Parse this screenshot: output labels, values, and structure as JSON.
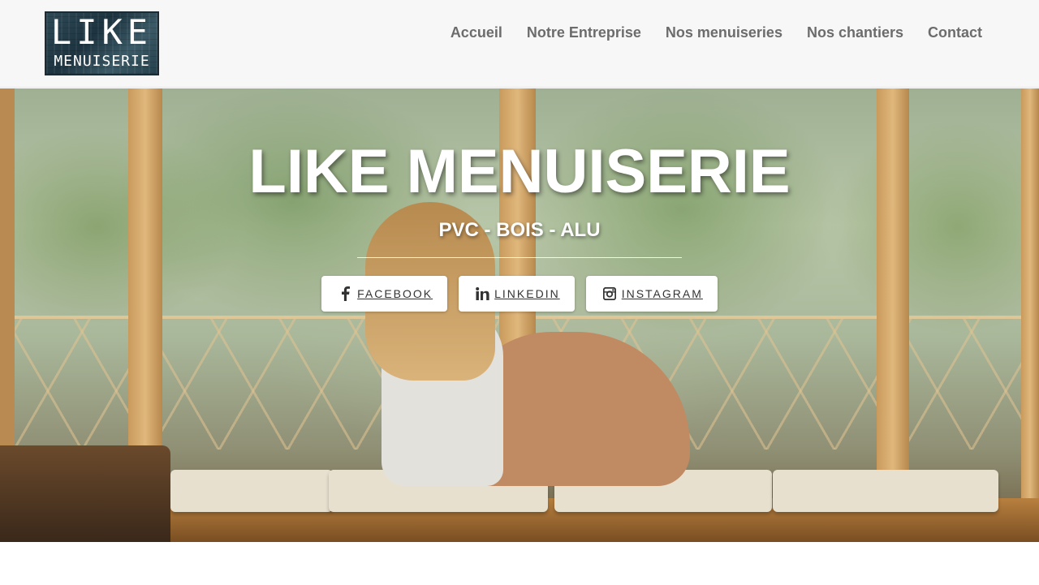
{
  "header": {
    "logo": {
      "line1": "LIKE",
      "line2": "MENUISERIE"
    },
    "nav": [
      {
        "label": "Accueil"
      },
      {
        "label": "Notre Entreprise"
      },
      {
        "label": "Nos menuiseries"
      },
      {
        "label": "Nos chantiers"
      },
      {
        "label": "Contact"
      }
    ]
  },
  "hero": {
    "title": "LIKE MENUISERIE",
    "subtitle": "PVC - BOIS - ALU",
    "social_buttons": [
      {
        "label": "FACEBOOK",
        "icon": "facebook-icon"
      },
      {
        "label": "LINKEDIN",
        "icon": "linkedin-icon"
      },
      {
        "label": "INSTAGRAM",
        "icon": "instagram-icon"
      }
    ]
  },
  "colors": {
    "header_bg": "#f7f7f7",
    "nav_text": "#6c6c6c",
    "hero_text": "#ffffff",
    "button_bg": "#ffffff",
    "button_text": "#333333"
  }
}
